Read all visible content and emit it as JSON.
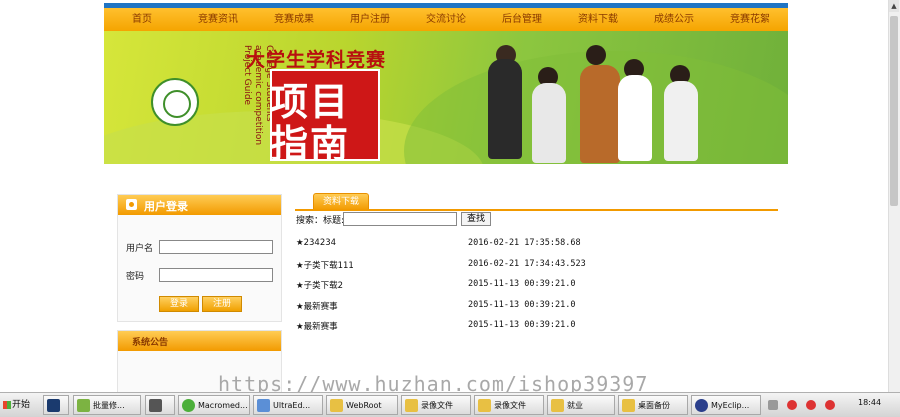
{
  "nav": {
    "items": [
      "首页",
      "竞赛资讯",
      "竞赛成果",
      "用户注册",
      "交流讨论",
      "后台管理",
      "资料下载",
      "成绩公示",
      "竞赛花絮"
    ]
  },
  "banner": {
    "title": "大学生学科竞赛",
    "subtitle_en": "College Students' academic competition Project Guide",
    "big_line1": "项目",
    "big_line2": "指南"
  },
  "login": {
    "title": "用户登录",
    "username_label": "用户名",
    "password_label": "密码",
    "login_button": "登录",
    "register_button": "注册"
  },
  "notice": {
    "title": "系统公告"
  },
  "downloads": {
    "tab_label": "资料下载",
    "search_label": "搜索：标题:",
    "search_value": "",
    "search_button": "查找",
    "rows": [
      {
        "name": "★234234",
        "time": "2016-02-21 17:35:58.68"
      },
      {
        "name": "★子类下载111",
        "time": "2016-02-21 17:34:43.523"
      },
      {
        "name": "★子类下载2",
        "time": "2015-11-13 00:39:21.0"
      },
      {
        "name": "★最新赛事",
        "time": "2015-11-13 00:39:21.0"
      },
      {
        "name": "★最新赛事",
        "time": "2015-11-13 00:39:21.0"
      }
    ]
  },
  "watermark": "https://www.huzhan.com/ishop39397",
  "taskbar": {
    "start_label": "开始",
    "items": [
      "批量修...",
      "Macromed...",
      "UltraEd...",
      "WebRoot",
      "录像文件",
      "录像文件",
      "就业",
      "桌面备份",
      "MyEclip..."
    ],
    "clock": "18:44"
  },
  "colors": {
    "accent": "#f29a00",
    "nav_bg": "#ffc02e",
    "banner_red": "#ce1717"
  }
}
